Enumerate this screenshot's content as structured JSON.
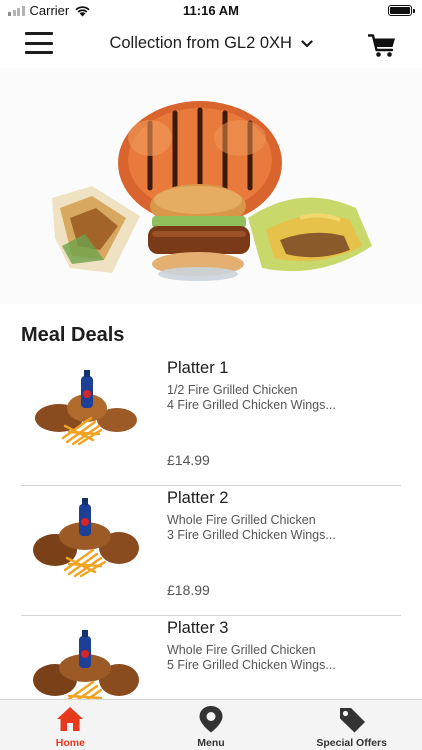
{
  "status_bar": {
    "carrier": "Carrier",
    "time": "11:16 AM"
  },
  "header": {
    "location": "Collection from GL2 0XH",
    "menu_icon": "hamburger-menu-icon",
    "cart_icon": "shopping-cart-icon"
  },
  "section": {
    "title": "Meal Deals"
  },
  "deals": [
    {
      "name": "Platter 1",
      "description": "1/2 Fire Grilled Chicken\n4 Fire Grilled Chicken Wings...",
      "price": "£14.99"
    },
    {
      "name": "Platter 2",
      "description": "Whole Fire Grilled Chicken\n3 Fire Grilled Chicken Wings...",
      "price": "£18.99"
    },
    {
      "name": "Platter 3",
      "description": "Whole Fire Grilled Chicken\n5 Fire Grilled Chicken Wings...",
      "price": ""
    }
  ],
  "tabbar": {
    "tabs": [
      {
        "label": "Home",
        "icon": "home-icon",
        "active": true
      },
      {
        "label": "Menu",
        "icon": "map-pin-icon",
        "active": false
      },
      {
        "label": "Special Offers",
        "icon": "price-tag-icon",
        "active": false
      }
    ]
  },
  "colors": {
    "accent": "#e8391f",
    "text": "#1d1d1d",
    "secondary_text": "#555555",
    "tabbar_bg": "#f4f4f4"
  }
}
